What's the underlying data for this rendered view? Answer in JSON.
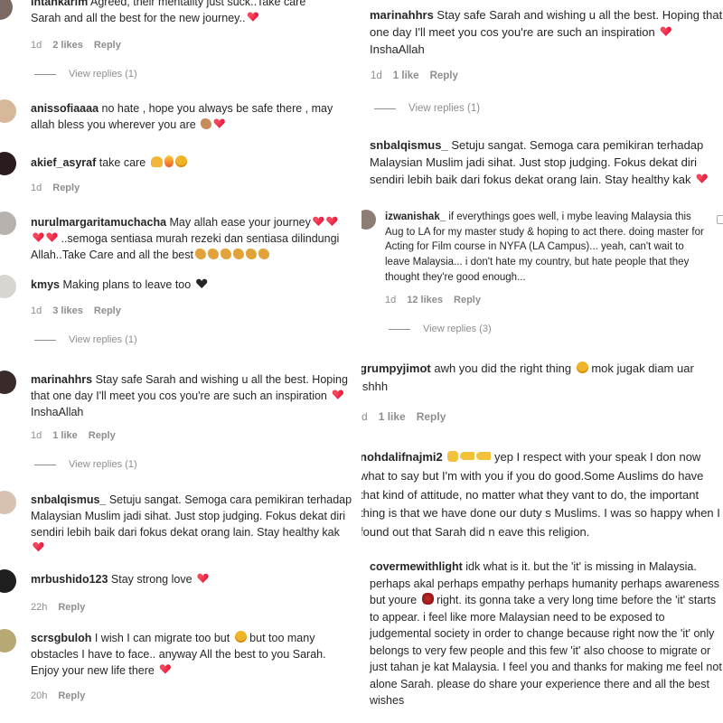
{
  "left": {
    "comments": [
      {
        "user": "intankarim",
        "text": " Agreed, their mentality just suck..Take care Sarah and all the best for the new journey..",
        "emojis": [
          "heart"
        ],
        "time": "1d",
        "likes": "2 likes",
        "reply": "Reply",
        "view_replies": "View replies (1)"
      },
      {
        "user": "anissofiaaaa",
        "text": " no hate , hope you always be safe there , may allah bless you wherever you are ",
        "emojis": [
          "flexed-biceps",
          "heart"
        ]
      },
      {
        "user": "akief_asyraf",
        "text": " take care ",
        "emojis": [
          "raised-hands",
          "fire",
          "sad-face"
        ],
        "time": "1d",
        "reply": "Reply"
      },
      {
        "user": "nurulmargaritamuchacha",
        "text": " May allah ease your journey",
        "text2": " ..semoga sentiasa murah rezeki dan sentiasa dilindungi Allah..Take Care and all the best",
        "emojis": [
          "heart",
          "heart",
          "heart",
          "heart"
        ],
        "emojis2": [
          "flexed-biceps",
          "flexed-biceps",
          "flexed-biceps",
          "flexed-biceps",
          "flexed-biceps",
          "flexed-biceps"
        ]
      },
      {
        "user": "kmys",
        "text": " Making plans to leave too ",
        "emojis": [
          "black-heart"
        ],
        "time": "1d",
        "likes": "3 likes",
        "reply": "Reply",
        "view_replies": "View replies (1)"
      },
      {
        "user": "marinahhrs",
        "text": " Stay safe Sarah and wishing u all the best. Hoping that one day I'll meet you cos you're are such an inspiration ",
        "text_end": " InshaAllah",
        "emojis": [
          "heart"
        ],
        "time": "1d",
        "likes": "1 like",
        "reply": "Reply",
        "view_replies": "View replies (1)"
      },
      {
        "user": "snbalqismus_",
        "text": " Setuju sangat. Semoga cara pemikiran terhadap Malaysian Muslim jadi sihat. Just stop judging. Fokus dekat diri sendiri lebih baik dari fokus dekat orang lain. Stay healthy kak",
        "emojis": [
          "heart"
        ]
      },
      {
        "user": "mrbushido123",
        "text": " Stay strong love ",
        "emojis": [
          "heart"
        ],
        "time": "22h",
        "reply": "Reply"
      },
      {
        "user": "scrsgbuloh",
        "text": " I wish I can migrate too but ",
        "text_mid": " but too many obstacles I have to face.. anyway All the best to you Sarah. Enjoy your new life there ",
        "emojis": [
          "sad-face"
        ],
        "emojis_end": [
          "heart"
        ],
        "time": "20h",
        "reply": "Reply"
      }
    ]
  },
  "right": {
    "comments": [
      {
        "user": "marinahhrs",
        "text": " Stay safe Sarah and wishing u all the best. Hoping that one day I'll meet you cos you're are such an inspiration ",
        "text_end": " InshaAllah",
        "emojis": [
          "heart"
        ],
        "time": "1d",
        "likes": "1 like",
        "reply": "Reply",
        "view_replies": "View replies (1)"
      },
      {
        "user": "snbalqismus_",
        "text": " Setuju sangat. Semoga cara pemikiran terhadap Malaysian Muslim jadi sihat. Just stop judging. Fokus dekat diri sendiri lebih baik dari fokus dekat orang lain. Stay healthy kak",
        "emojis": [
          "heart"
        ]
      },
      {
        "user": "izwanishak_",
        "text": " if everythings goes well, i mybe leaving Malaysia this Aug to LA for my master study & hoping to act there. doing master for Acting for Film course in NYFA (LA Campus)... yeah, can't wait to leave Malaysia... i don't hate my country, but hate people that they thought they're good enough...",
        "time": "1d",
        "likes": "12 likes",
        "reply": "Reply",
        "view_replies": "View replies (3)"
      },
      {
        "user": "grumpyjimot",
        "text": " awh you did the right thing ",
        "text_end": " mok jugak diam uar ishhh",
        "emojis": [
          "sad-face"
        ],
        "time": "d",
        "likes": "1 like",
        "reply": "Reply"
      },
      {
        "user": "nohdalifnajmi2",
        "text": " yep I respect with your speak I don now what to say but I'm with you if you do good.Some Auslims do have that kind of attitude, no matter what they vant to do, the important thing is that we have done our duty s Muslims. I was so happy when I found out that Sarah did n eave this religion.",
        "emojis": [
          "thumbs-up",
          "pointing-hand",
          "pointing-hand"
        ]
      },
      {
        "user": "covermewithlight",
        "text": " idk what is it. but the 'it' is missing in Malaysia. perhaps akal perhaps empathy perhaps humanity perhaps awareness but youre ",
        "text_end": " right. its gonna take a very long time before the 'it' starts to appear. i feel like more Malaysian need to be exposed to judgemental society in order to change because right now the 'it' only belongs to very few people and this few 'it' also choose to migrate or just tahan je kat Malaysia. I feel you and thanks for making me feel not alone Sarah. please do share your experience there and all the best wishes",
        "emojis": [
          "rose"
        ]
      }
    ]
  }
}
